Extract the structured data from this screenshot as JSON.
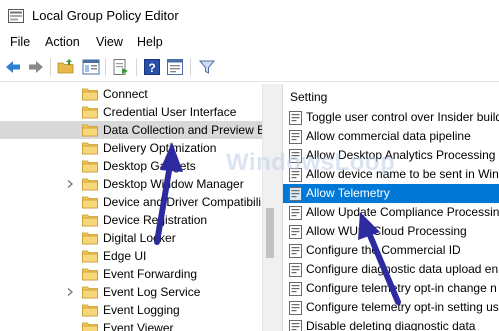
{
  "window": {
    "title": "Local Group Policy Editor"
  },
  "menu": [
    "File",
    "Action",
    "View",
    "Help"
  ],
  "toolbar": {
    "icons": [
      "back-icon",
      "forward-icon",
      "up-folder-icon",
      "show-hide-tree-icon",
      "export-list-icon",
      "help-icon",
      "properties-icon",
      "filter-icon"
    ]
  },
  "tree": {
    "items": [
      {
        "label": "Connect",
        "expandable": false,
        "selected": false
      },
      {
        "label": "Credential User Interface",
        "expandable": false,
        "selected": false
      },
      {
        "label": "Data Collection and Preview B",
        "expandable": false,
        "selected": true
      },
      {
        "label": "Delivery Optimization",
        "expandable": false,
        "selected": false
      },
      {
        "label": "Desktop Gadgets",
        "expandable": false,
        "selected": false
      },
      {
        "label": "Desktop Window Manager",
        "expandable": true,
        "selected": false
      },
      {
        "label": "Device and Driver Compatibili",
        "expandable": false,
        "selected": false
      },
      {
        "label": "Device Registration",
        "expandable": false,
        "selected": false
      },
      {
        "label": "Digital Locker",
        "expandable": false,
        "selected": false
      },
      {
        "label": "Edge UI",
        "expandable": false,
        "selected": false
      },
      {
        "label": "Event Forwarding",
        "expandable": false,
        "selected": false
      },
      {
        "label": "Event Log Service",
        "expandable": true,
        "selected": false
      },
      {
        "label": "Event Logging",
        "expandable": false,
        "selected": false
      },
      {
        "label": "Event Viewer",
        "expandable": false,
        "selected": false
      }
    ]
  },
  "settings": {
    "header": "Setting",
    "items": [
      {
        "label": "Toggle user control over Insider build",
        "selected": false
      },
      {
        "label": "Allow commercial data pipeline",
        "selected": false
      },
      {
        "label": "Allow Desktop Analytics Processing",
        "selected": false
      },
      {
        "label": "Allow device name to be sent in Win",
        "selected": false
      },
      {
        "label": "Allow Telemetry",
        "selected": true
      },
      {
        "label": "Allow Update Compliance Processing",
        "selected": false
      },
      {
        "label": "Allow WUfB Cloud Processing",
        "selected": false
      },
      {
        "label": "Configure the Commercial ID",
        "selected": false
      },
      {
        "label": "Configure diagnostic data upload en",
        "selected": false
      },
      {
        "label": "Configure telemetry opt-in change n",
        "selected": false
      },
      {
        "label": "Configure telemetry opt-in setting us",
        "selected": false
      },
      {
        "label": "Disable deleting diagnostic data",
        "selected": false
      }
    ]
  },
  "watermark": "WindowsLoop",
  "colors": {
    "selection_blue": "#0078d7",
    "tree_selection": "#d9d9d9",
    "arrow": "#2e2aa0"
  }
}
